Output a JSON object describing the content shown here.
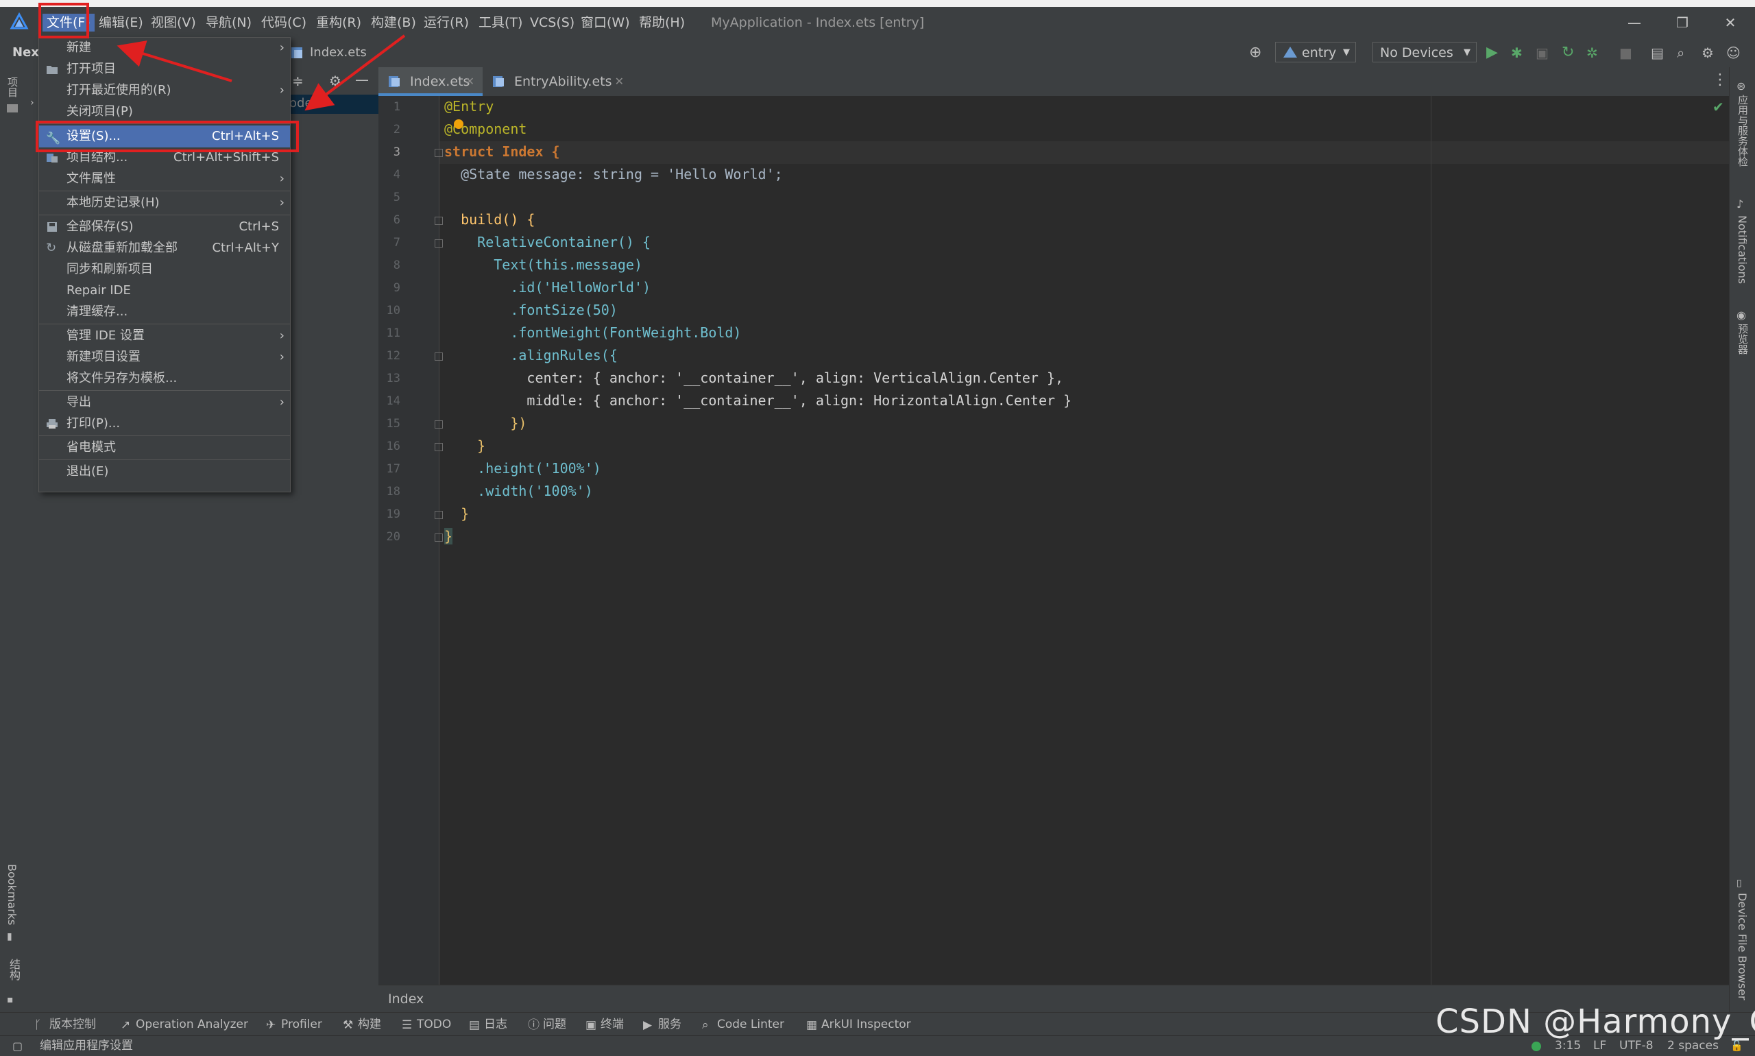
{
  "menubar": {
    "items": [
      "文件(F)",
      "编辑(E)",
      "视图(V)",
      "导航(N)",
      "代码(C)",
      "重构(R)",
      "构建(B)",
      "运行(R)",
      "工具(T)",
      "VCS(S)",
      "窗口(W)",
      "帮助(H)"
    ],
    "window_title": "MyApplication - Index.ets [entry]"
  },
  "toolbar": {
    "project_name": "Next",
    "breadcrumb_file": "Index.ets",
    "run_config": "entry",
    "device": "No Devices"
  },
  "project_panel": {
    "partial_text": "ode"
  },
  "file_menu": {
    "items": [
      {
        "label": "新建",
        "shortcut": "",
        "submenu": true,
        "icon": ""
      },
      {
        "label": "打开项目",
        "shortcut": "",
        "submenu": false,
        "icon": "folder-icon"
      },
      {
        "label": "打开最近使用的(R)",
        "shortcut": "",
        "submenu": true,
        "icon": ""
      },
      {
        "label": "关闭项目(P)",
        "shortcut": "",
        "submenu": false,
        "icon": ""
      },
      {
        "label": "设置(S)...",
        "shortcut": "Ctrl+Alt+S",
        "submenu": false,
        "icon": "wrench-icon",
        "selected": true
      },
      {
        "label": "项目结构...",
        "shortcut": "Ctrl+Alt+Shift+S",
        "submenu": false,
        "icon": "project-structure-icon"
      },
      {
        "label": "文件属性",
        "shortcut": "",
        "submenu": true,
        "icon": ""
      },
      {
        "label": "本地历史记录(H)",
        "shortcut": "",
        "submenu": true,
        "icon": ""
      },
      {
        "label": "全部保存(S)",
        "shortcut": "Ctrl+S",
        "submenu": false,
        "icon": "save-icon"
      },
      {
        "label": "从磁盘重新加载全部",
        "shortcut": "Ctrl+Alt+Y",
        "submenu": false,
        "icon": "reload-icon"
      },
      {
        "label": "同步和刷新项目",
        "shortcut": "",
        "submenu": false,
        "icon": ""
      },
      {
        "label": "Repair IDE",
        "shortcut": "",
        "submenu": false,
        "icon": ""
      },
      {
        "label": "清理缓存...",
        "shortcut": "",
        "submenu": false,
        "icon": ""
      },
      {
        "label": "管理 IDE 设置",
        "shortcut": "",
        "submenu": true,
        "icon": ""
      },
      {
        "label": "新建项目设置",
        "shortcut": "",
        "submenu": true,
        "icon": ""
      },
      {
        "label": "将文件另存为模板...",
        "shortcut": "",
        "submenu": false,
        "icon": ""
      },
      {
        "label": "导出",
        "shortcut": "",
        "submenu": true,
        "icon": ""
      },
      {
        "label": "打印(P)...",
        "shortcut": "",
        "submenu": false,
        "icon": "print-icon"
      },
      {
        "label": "省电模式",
        "shortcut": "",
        "submenu": false,
        "icon": ""
      },
      {
        "label": "退出(E)",
        "shortcut": "",
        "submenu": false,
        "icon": ""
      }
    ]
  },
  "editor": {
    "tabs": [
      {
        "label": "Index.ets",
        "active": true
      },
      {
        "label": "EntryAbility.ets",
        "active": false
      }
    ],
    "current_line": 3,
    "code_lines": [
      "@Entry",
      "@Component",
      "struct Index {",
      "  @State message: string = 'Hello World';",
      "",
      "  build() {",
      "    RelativeContainer() {",
      "      Text(this.message)",
      "        .id('HelloWorld')",
      "        .fontSize(50)",
      "        .fontWeight(FontWeight.Bold)",
      "        .alignRules({",
      "          center: { anchor: '__container__', align: VerticalAlign.Center },",
      "          middle: { anchor: '__container__', align: HorizontalAlign.Center }",
      "        })",
      "    }",
      "    .height('100%')",
      "    .width('100%')",
      "  }",
      "}"
    ],
    "breadcrumb": "Index"
  },
  "left_rail": {
    "top_label": "项目",
    "bookmarks": "Bookmarks",
    "structure": "结构"
  },
  "right_rail": {
    "items": [
      "应用与服务体检",
      "Notifications",
      "预览器",
      "Device File Browser"
    ]
  },
  "tool_windows": [
    {
      "label": "版本控制",
      "icon": "branch-icon"
    },
    {
      "label": "Operation Analyzer",
      "icon": "chart-icon"
    },
    {
      "label": "Profiler",
      "icon": "profiler-icon"
    },
    {
      "label": "构建",
      "icon": "hammer-icon"
    },
    {
      "label": "TODO",
      "icon": "list-icon"
    },
    {
      "label": "日志",
      "icon": "log-icon"
    },
    {
      "label": "问题",
      "icon": "info-icon"
    },
    {
      "label": "终端",
      "icon": "terminal-icon"
    },
    {
      "label": "服务",
      "icon": "play-circle-icon"
    },
    {
      "label": "Code Linter",
      "icon": "linter-icon"
    },
    {
      "label": "ArkUI Inspector",
      "icon": "inspector-icon"
    }
  ],
  "status_bar": {
    "message": "编辑应用程序设置",
    "position": "3:15",
    "line_ending": "LF",
    "encoding": "UTF-8",
    "indent": "2 spaces"
  },
  "watermark": "CSDN @Harmony_QI",
  "colors": {
    "accent": "#4b6eaf",
    "annotation_red": "#e02020",
    "panel_bg": "#3c3f41",
    "editor_bg": "#2b2b2b"
  }
}
